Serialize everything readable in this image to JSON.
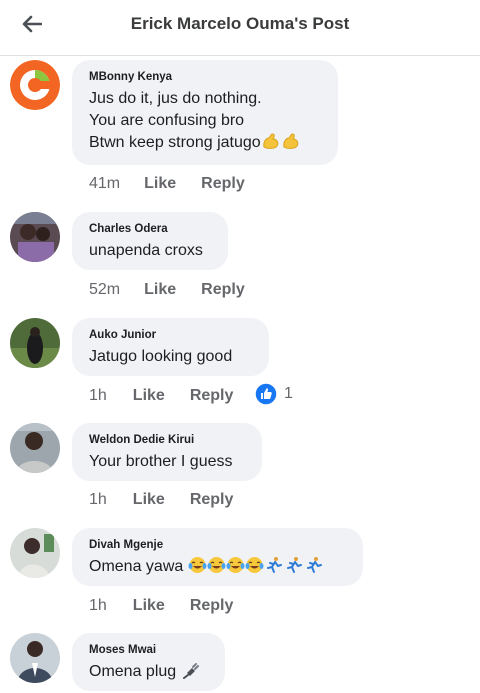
{
  "header": {
    "title": "Erick Marcelo Ouma's Post",
    "back_icon": "arrow-left-icon"
  },
  "colors": {
    "bubble": "#f0f2f5",
    "meta": "#65676b",
    "like_badge": "#1877f2",
    "avatar_ring": "#f26522",
    "avatar_ring_green": "#8dc63f"
  },
  "comments": [
    {
      "author": "MBonny Kenya",
      "lines": [
        "Jus do it, jus do nothing.",
        "You are confusing bro",
        "Btwn keep strong jatugo"
      ],
      "emojis": [
        "flexed-biceps",
        "flexed-biceps"
      ],
      "time": "41m",
      "like": "Like",
      "reply": "Reply"
    },
    {
      "author": "Charles Odera",
      "lines": [
        "unapenda croxs"
      ],
      "time": "52m",
      "like": "Like",
      "reply": "Reply"
    },
    {
      "author": "Auko Junior",
      "lines": [
        "Jatugo looking good"
      ],
      "time": "1h",
      "like": "Like",
      "reply": "Reply",
      "reaction": {
        "icon": "thumbs-up-icon",
        "count": "1"
      }
    },
    {
      "author": "Weldon Dedie Kirui",
      "lines": [
        "Your brother I guess"
      ],
      "time": "1h",
      "like": "Like",
      "reply": "Reply"
    },
    {
      "author": "Divah Mgenje",
      "lines": [
        "Omena yawa"
      ],
      "emojis": [
        "tears-of-joy",
        "tears-of-joy",
        "tears-of-joy",
        "tears-of-joy",
        "running-person",
        "running-person",
        "running-person"
      ],
      "time": "1h",
      "like": "Like",
      "reply": "Reply"
    },
    {
      "author": "Moses Mwai",
      "lines": [
        "Omena plug"
      ],
      "emojis": [
        "electric-plug"
      ]
    }
  ]
}
